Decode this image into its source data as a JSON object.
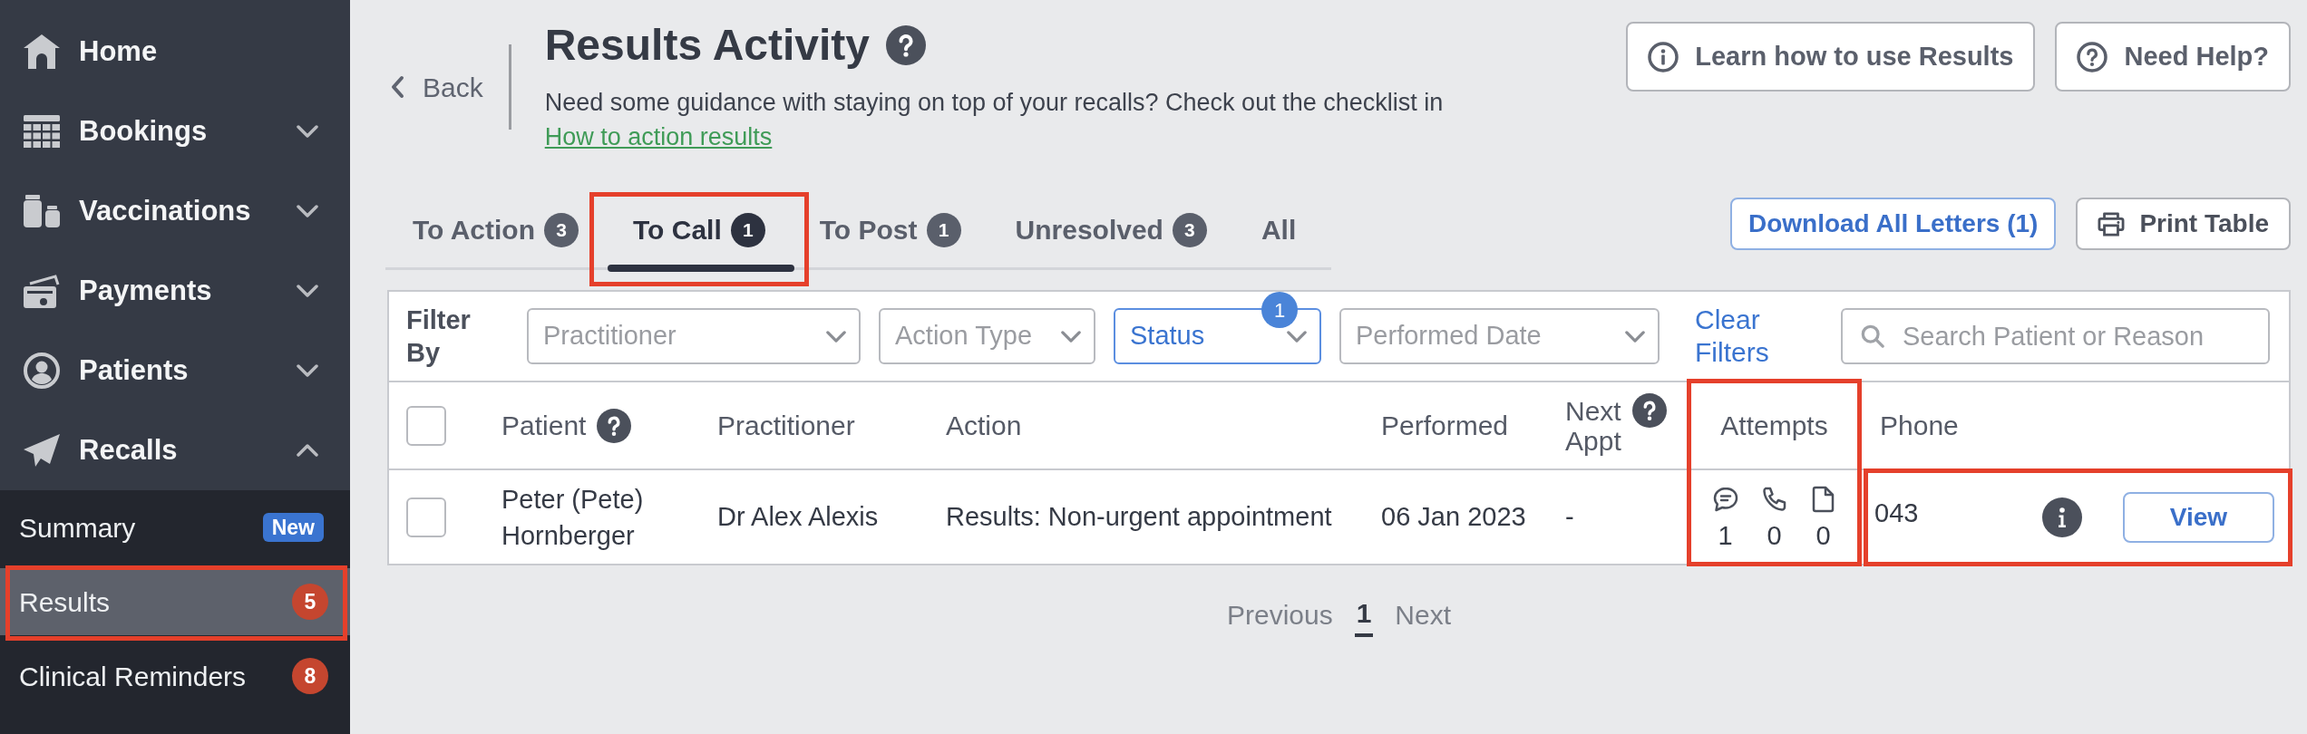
{
  "sidebar": {
    "items": [
      {
        "label": "Home",
        "kind": "link"
      },
      {
        "label": "Bookings",
        "kind": "group",
        "expanded": false
      },
      {
        "label": "Vaccinations",
        "kind": "group",
        "expanded": false
      },
      {
        "label": "Payments",
        "kind": "group",
        "expanded": false
      },
      {
        "label": "Patients",
        "kind": "group",
        "expanded": false
      },
      {
        "label": "Recalls",
        "kind": "group",
        "expanded": true,
        "children": [
          {
            "label": "Summary",
            "selected": false,
            "highlighted": false,
            "badge": {
              "kind": "label",
              "text": "New"
            }
          },
          {
            "label": "Results",
            "selected": true,
            "highlighted": true,
            "badge": {
              "kind": "count",
              "text": "5"
            }
          },
          {
            "label": "Clinical Reminders",
            "selected": false,
            "highlighted": false,
            "badge": {
              "kind": "count",
              "text": "8"
            }
          }
        ]
      }
    ]
  },
  "header": {
    "back": "Back",
    "title": "Results Activity",
    "guidance": "Need some guidance with staying on top of your recalls? Check out the checklist in",
    "guidance_link": "How to action results",
    "buttons": [
      {
        "label": "Learn how to use Results"
      },
      {
        "label": "Need Help?"
      }
    ]
  },
  "tabs": [
    {
      "label": "To Action",
      "count": "3",
      "selected": false,
      "highlighted": false
    },
    {
      "label": "To Call",
      "count": "1",
      "selected": true,
      "highlighted": true
    },
    {
      "label": "To Post",
      "count": "1",
      "selected": false,
      "highlighted": false
    },
    {
      "label": "Unresolved",
      "count": "3",
      "selected": false,
      "highlighted": false
    },
    {
      "label": "All",
      "selected": false,
      "highlighted": false
    }
  ],
  "actions": [
    {
      "label": "Download All Letters (1)",
      "kind": "primary"
    },
    {
      "label": "Print Table",
      "kind": "secondary"
    }
  ],
  "filters": {
    "label": "Filter By",
    "dropdowns": [
      {
        "label": "Practitioner",
        "active": false
      },
      {
        "label": "Action Type",
        "active": false
      },
      {
        "label": "Status",
        "active": true,
        "count": "1"
      },
      {
        "label": "Performed Date",
        "active": false
      }
    ],
    "clear": "Clear Filters",
    "search": {
      "placeholder": "Search Patient or Reason"
    }
  },
  "table": {
    "header_checked": false,
    "columns": [
      {
        "label": "Patient",
        "help": true,
        "highlighted": false
      },
      {
        "label": "Practitioner",
        "help": false,
        "highlighted": false
      },
      {
        "label": "Action",
        "help": false,
        "highlighted": false
      },
      {
        "label": "Performed",
        "help": false,
        "highlighted": false
      },
      {
        "label": "Next Appt",
        "help": true,
        "highlighted": false
      },
      {
        "label": "Attempts",
        "help": false,
        "highlighted": true
      },
      {
        "label": "Phone",
        "help": false,
        "highlighted": false
      }
    ],
    "rows": [
      {
        "checked": false,
        "patient": "Peter (Pete) Hornberger",
        "practitioner": "Dr Alex Alexis",
        "action": "Results: Non-urgent appointment",
        "performed": "06 Jan 2023",
        "next_appt": "-",
        "attempts": [
          {
            "kind": "message",
            "count": "1"
          },
          {
            "kind": "call",
            "count": "0"
          },
          {
            "kind": "document",
            "count": "0"
          }
        ],
        "phone": "043",
        "phone_highlighted": true,
        "view": "View"
      }
    ]
  },
  "pagination": {
    "previous": "Previous",
    "pages": [
      {
        "label": "1",
        "selected": true
      }
    ],
    "next": "Next"
  }
}
